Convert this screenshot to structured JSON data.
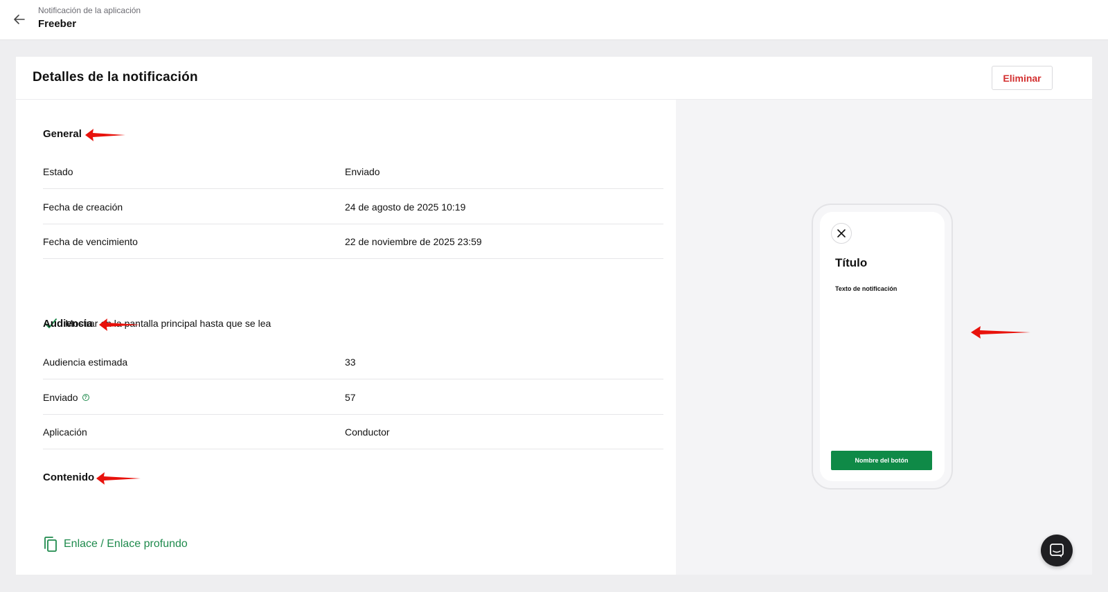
{
  "topbar": {
    "subtitle": "Notificación de la aplicación",
    "title": "Freeber"
  },
  "card": {
    "title": "Detalles de la notificación",
    "delete_label": "Eliminar"
  },
  "general": {
    "heading": "General",
    "rows": [
      {
        "label": "Estado",
        "value": "Enviado"
      },
      {
        "label": "Fecha de creación",
        "value": "24 de agosto de 2025 10:19"
      },
      {
        "label": "Fecha de vencimiento",
        "value": "22 de noviembre de 2025 23:59"
      }
    ],
    "check_label": "Mostrar en la pantalla principal hasta que se lea"
  },
  "audience": {
    "heading": "Audiencia",
    "rows": [
      {
        "label": "Audiencia estimada",
        "value": "33"
      },
      {
        "label": "Enviado",
        "value": "57"
      },
      {
        "label": "Aplicación",
        "value": "Conductor"
      }
    ]
  },
  "content": {
    "heading": "Contenido",
    "link_label": "Enlace / Enlace profundo"
  },
  "preview": {
    "title": "Título",
    "text": "Texto de notificación",
    "button_label": "Nombre del botón"
  },
  "colors": {
    "accent_green": "#0f8a47",
    "danger_red": "#d32f2f",
    "annotation_red": "#e8120c"
  },
  "icons": {
    "back": "arrow-left-icon",
    "check": "check-icon",
    "help": "help-circle-icon",
    "copy": "copy-icon",
    "close": "close-icon",
    "chat": "chat-icon"
  }
}
